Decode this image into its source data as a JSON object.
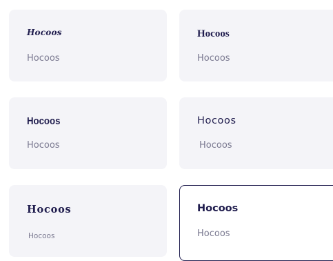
{
  "font_cards": [
    {
      "heading": "Hocoos",
      "sub": "Hocoos",
      "selected": false
    },
    {
      "heading": "Hocoos",
      "sub": "Hocoos",
      "selected": false
    },
    {
      "heading": "Hocoos",
      "sub": "Hocoos",
      "selected": false
    },
    {
      "heading": "Hocoos",
      "sub": "Hocoos",
      "selected": false
    },
    {
      "heading": "Hocoos",
      "sub": "Hocoos",
      "selected": false
    },
    {
      "heading": "Hocoos",
      "sub": "Hocoos",
      "selected": true
    }
  ],
  "colors": {
    "card_bg": "#f4f4f8",
    "heading": "#1f1c4d",
    "subtext": "#7a7990",
    "selected_border": "#1f1c4d"
  }
}
